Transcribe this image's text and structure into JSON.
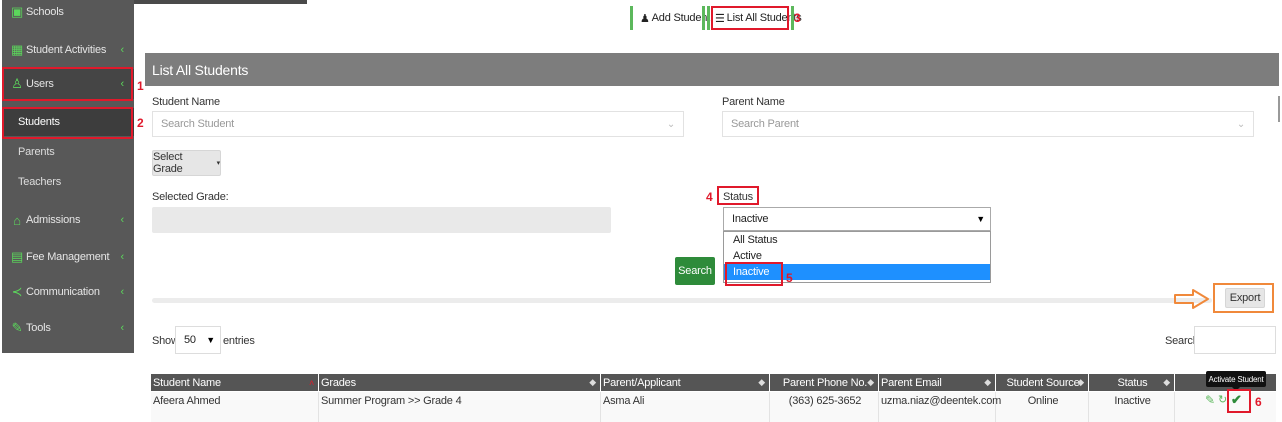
{
  "sidebar": {
    "schools": "Schools",
    "student_activities": "Student Activities",
    "users": "Users",
    "students": "Students",
    "parents": "Parents",
    "teachers": "Teachers",
    "admissions": "Admissions",
    "fee_management": "Fee Management",
    "communication": "Communication",
    "tools": "Tools"
  },
  "top_actions": {
    "add_student": "Add Student",
    "list_all_students": "List All Students"
  },
  "panel": {
    "title": "List All Students",
    "student_name_label": "Student Name",
    "student_name_placeholder": "Search Student",
    "parent_name_label": "Parent Name",
    "parent_name_placeholder": "Search Parent",
    "select_grade": "Select Grade",
    "selected_grade_label": "Selected Grade:",
    "status_label": "Status",
    "status_value": "Inactive",
    "status_options": [
      "All Status",
      "Active",
      "Inactive"
    ],
    "search_button": "Search",
    "export_button": "Export"
  },
  "table_controls": {
    "show": "Show",
    "entries_value": "50",
    "entries": "entries",
    "search_label": "Search:"
  },
  "table": {
    "headers": [
      "Student Name",
      "Grades",
      "Parent/Applicant",
      "Parent Phone No.",
      "Parent Email",
      "Student Source",
      "Status"
    ],
    "row": {
      "student_name": "Afeera Ahmed",
      "grade": "Summer Program >> Grade 4",
      "parent": "Asma Ali",
      "phone": "(363) 625-3652",
      "email": "uzma.niaz@deentek.com",
      "source": "Online",
      "status": "Inactive"
    },
    "tooltip": "Activate Student"
  },
  "annotations": [
    "1",
    "2",
    "3",
    "4",
    "5",
    "6"
  ],
  "colors": {
    "sidebar_bg": "#585858",
    "accent_green": "#5cd65c",
    "annotation_red": "#e0192b",
    "annotation_orange": "#f0893b",
    "selected_option_blue": "#1e90ff"
  }
}
